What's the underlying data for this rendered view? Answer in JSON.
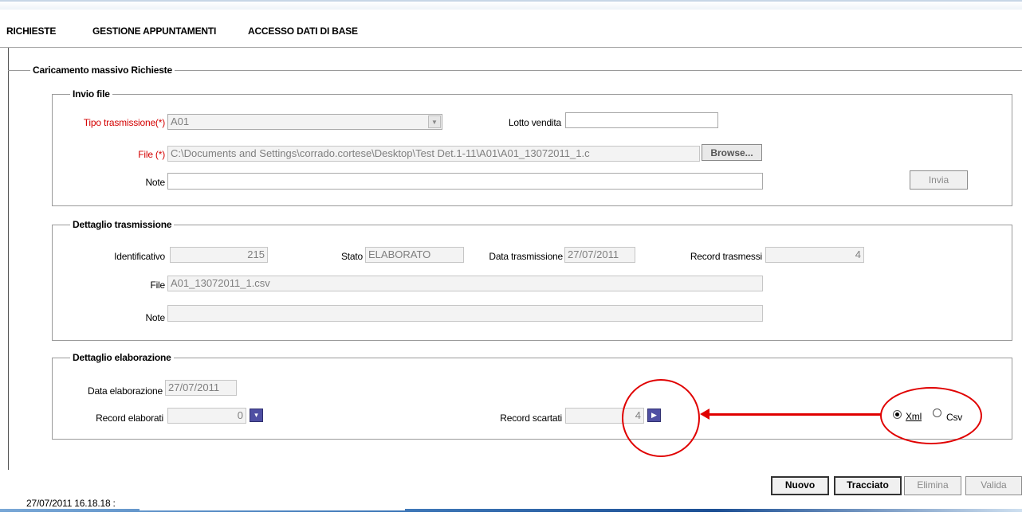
{
  "menu": {
    "items": [
      "RICHIESTE",
      "GESTIONE APPUNTAMENTI",
      "ACCESSO DATI DI BASE"
    ]
  },
  "main": {
    "legend": "Caricamento massivo Richieste"
  },
  "invio_file": {
    "legend": "Invio file",
    "tipo_label": "Tipo trasmissione(*)",
    "tipo_value": "A01",
    "lotto_label": "Lotto vendita",
    "lotto_value": "",
    "file_label": "File (*)",
    "file_value": "C:\\Documents and Settings\\corrado.cortese\\Desktop\\Test Det.1-11\\A01\\A01_13072011_1.c",
    "browse_label": "Browse...",
    "note_label": "Note",
    "note_value": "",
    "invia_label": "Invia"
  },
  "dettaglio_trasmissione": {
    "legend": "Dettaglio trasmissione",
    "id_label": "Identificativo",
    "id_value": "215",
    "stato_label": "Stato",
    "stato_value": "ELABORATO",
    "data_label": "Data trasmissione",
    "data_value": "27/07/2011",
    "record_label": "Record trasmessi",
    "record_value": "4",
    "file_label": "File",
    "file_value": "A01_13072011_1.csv",
    "note_label": "Note",
    "note_value": ""
  },
  "dettaglio_elaborazione": {
    "legend": "Dettaglio elaborazione",
    "data_label": "Data elaborazione",
    "data_value": "27/07/2011",
    "elaborati_label": "Record elaborati",
    "elaborati_value": "0",
    "scartati_label": "Record scartati",
    "scartati_value": "4",
    "format_options": [
      "Xml",
      "Csv"
    ],
    "format_selected": "Xml"
  },
  "actions": {
    "nuovo": "Nuovo",
    "tracciato": "Tracciato",
    "elimina": "Elimina",
    "valida": "Valida"
  },
  "status": {
    "timestamp": "27/07/2011 16.18.18  :"
  },
  "colors": {
    "annotation": "#e00000",
    "required_label": "#d40000",
    "action_button": "#4f4fa3"
  }
}
